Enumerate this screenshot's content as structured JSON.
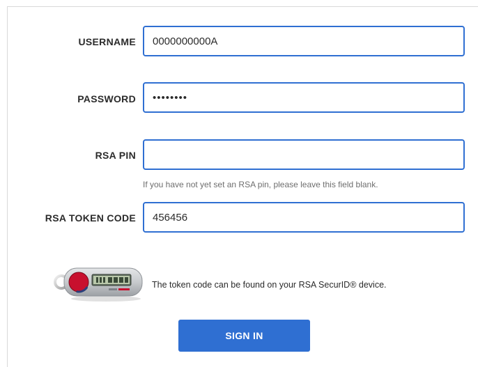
{
  "form": {
    "username": {
      "label": "USERNAME",
      "value": "0000000000A"
    },
    "password": {
      "label": "PASSWORD",
      "value": "••••••••"
    },
    "rsa_pin": {
      "label": "RSA PIN",
      "value": "",
      "hint": "If you have not yet set an RSA pin, please leave this field blank."
    },
    "rsa_token_code": {
      "label": "RSA TOKEN CODE",
      "value": "456456"
    }
  },
  "token_info": {
    "device_icon": "rsa-securid-token-icon",
    "note": "The token code can be found on your RSA SecurID® device."
  },
  "actions": {
    "sign_in_label": "SIGN IN"
  },
  "colors": {
    "accent": "#2f6fd2",
    "label_text": "#2b2b2b",
    "hint_text": "#6e6e6e"
  }
}
